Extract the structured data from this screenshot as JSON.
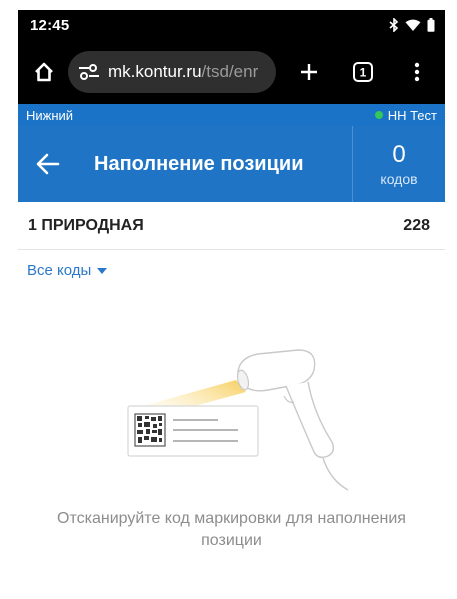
{
  "status": {
    "time": "12:45"
  },
  "browser": {
    "url_host": "mk.kontur.ru",
    "url_path": "/tsd/enr",
    "tab_count": "1"
  },
  "location": {
    "left": "Нижний",
    "right": "НН Тест",
    "status_color": "#34c759"
  },
  "header": {
    "title": "Наполнение позиции",
    "count": "0",
    "count_label": "кодов",
    "bg": "#1f74c5"
  },
  "product": {
    "name": "1 ПРИРОДНАЯ",
    "count": "228"
  },
  "filter": {
    "label": "Все коды"
  },
  "empty_state": {
    "hint": "Отсканируйте код маркировки для наполнения позиции"
  },
  "colors": {
    "accent": "#1f74c5",
    "link": "#2b78c9"
  }
}
